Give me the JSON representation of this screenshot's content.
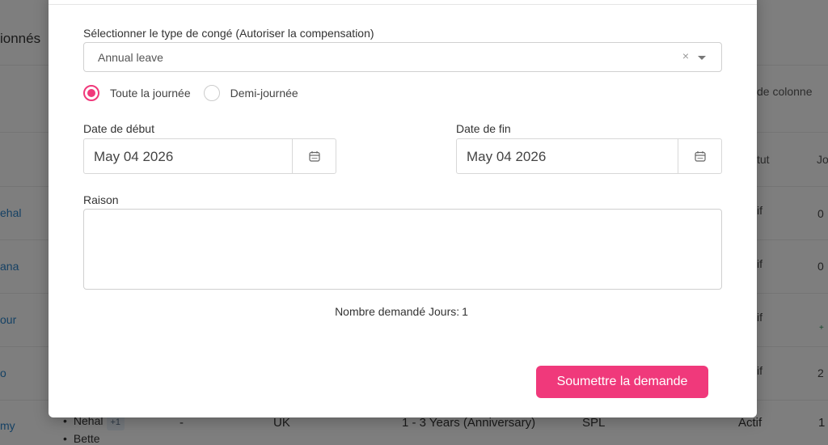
{
  "background": {
    "heading": "ionnés",
    "column_settings": "de colonne",
    "col_status": "tut",
    "col_days": "Jo",
    "rows": [
      {
        "name": "ehal",
        "status": "if",
        "days": "0"
      },
      {
        "name": "ana",
        "status": "if",
        "days": "0"
      },
      {
        "name": "our",
        "status": "if",
        "days": ""
      },
      {
        "name": "o",
        "status": "if",
        "days": "2"
      },
      {
        "name": "my",
        "status": "Actif",
        "days": "1"
      }
    ],
    "plus_badge": "+",
    "bottom_row": {
      "dash": "-",
      "country": "UK",
      "tenure": "1 - 3 Years (Anniversary)",
      "type": "SPL",
      "list": [
        "Nehal",
        "Bette"
      ],
      "tag": "+1"
    }
  },
  "modal": {
    "leave_type_label": "Sélectionner le type de congé (Autoriser la compensation)",
    "leave_type_value": "Annual leave",
    "clear_symbol": "×",
    "radio_full_day": "Toute la journée",
    "radio_half_day": "Demi-journée",
    "start_date_label": "Date de début",
    "start_date_value": "May 04 2026",
    "end_date_label": "Date de fin",
    "end_date_value": "May 04 2026",
    "reason_label": "Raison",
    "requested_label": "Nombre demandé Jours:",
    "requested_value": "1",
    "submit_label": "Soumettre la demande",
    "accent_color": "#f0397b"
  }
}
